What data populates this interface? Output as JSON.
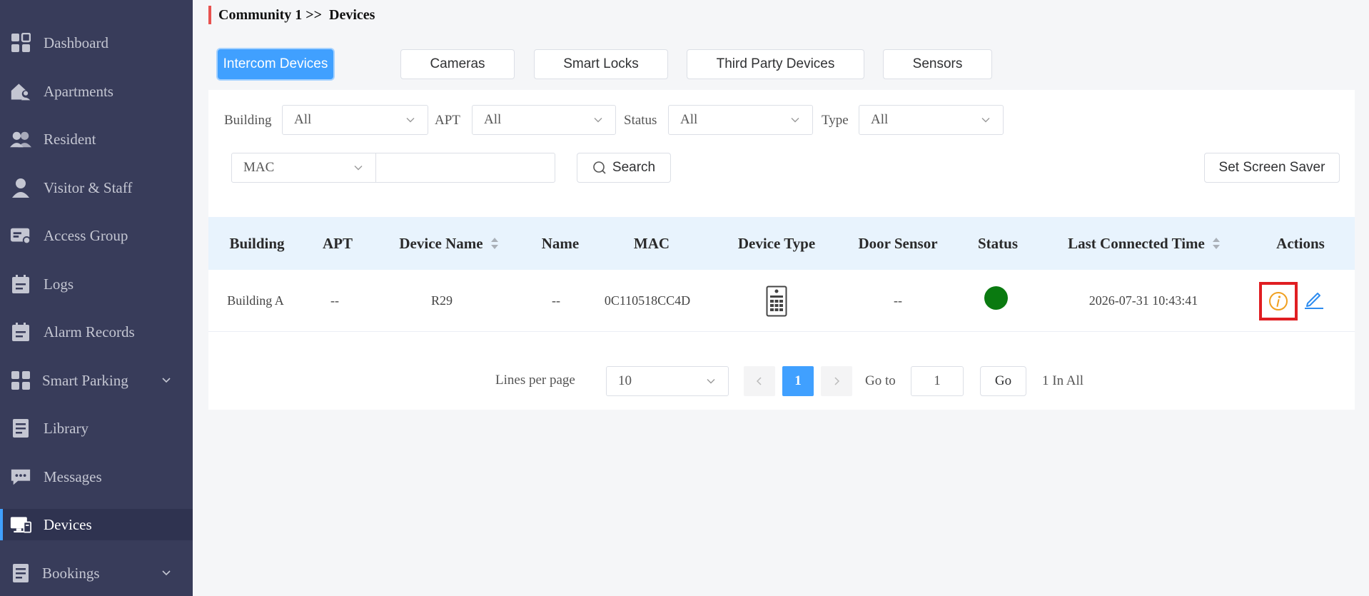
{
  "sidebar": {
    "items": [
      {
        "label": "Dashboard",
        "icon": "dashboard-icon"
      },
      {
        "label": "Apartments",
        "icon": "apartments-icon"
      },
      {
        "label": "Resident",
        "icon": "resident-icon"
      },
      {
        "label": "Visitor & Staff",
        "icon": "visitor-icon"
      },
      {
        "label": "Access Group",
        "icon": "access-group-icon"
      },
      {
        "label": "Logs",
        "icon": "logs-icon"
      },
      {
        "label": "Alarm Records",
        "icon": "alarm-records-icon"
      },
      {
        "label": "Smart Parking",
        "icon": "smart-parking-icon",
        "expandable": true
      },
      {
        "label": "Library",
        "icon": "library-icon"
      },
      {
        "label": "Messages",
        "icon": "messages-icon"
      },
      {
        "label": "Devices",
        "icon": "devices-icon",
        "active": true
      },
      {
        "label": "Bookings",
        "icon": "bookings-icon",
        "expandable": true
      }
    ]
  },
  "breadcrumb": {
    "community": "Community 1",
    "separator": " >> ",
    "page": " Devices"
  },
  "tabs": [
    {
      "label": "Intercom Devices",
      "active": true
    },
    {
      "label": "Cameras"
    },
    {
      "label": "Smart Locks"
    },
    {
      "label": "Third Party Devices"
    },
    {
      "label": "Sensors"
    }
  ],
  "filters": {
    "building": {
      "label": "Building",
      "value": "All"
    },
    "apt": {
      "label": "APT",
      "value": "All"
    },
    "status": {
      "label": "Status",
      "value": "All"
    },
    "type": {
      "label": "Type",
      "value": "All"
    },
    "search_field": {
      "value": "MAC"
    },
    "search_input": {
      "value": ""
    },
    "search_button": "Search",
    "screen_saver_button": "Set Screen Saver"
  },
  "table": {
    "headers": [
      "Building",
      "APT",
      "Device Name",
      "Name",
      "MAC",
      "Device Type",
      "Door Sensor",
      "Status",
      "Last Connected Time",
      "Actions"
    ],
    "rows": [
      {
        "building": "Building A",
        "apt": "--",
        "device_name": "R29",
        "name": "--",
        "mac": "0C110518CC4D",
        "device_type_icon": "door-phone-icon",
        "door_sensor": "--",
        "status": "online",
        "last_connected": "2026-07-31 10:43:41"
      }
    ]
  },
  "pagination": {
    "lines_per_page_label": "Lines per page",
    "lines_per_page": "10",
    "current_page": "1",
    "goto_label": "Go to",
    "goto_value": "1",
    "go_button": "Go",
    "total": "1 In All"
  },
  "colors": {
    "sidebar_bg": "#383c5a",
    "accent": "#40a0ff",
    "status_online": "#0a7a10",
    "info_icon": "#f0a020",
    "highlight_box": "#e01e22",
    "breadcrumb_bar": "#e8524f"
  }
}
